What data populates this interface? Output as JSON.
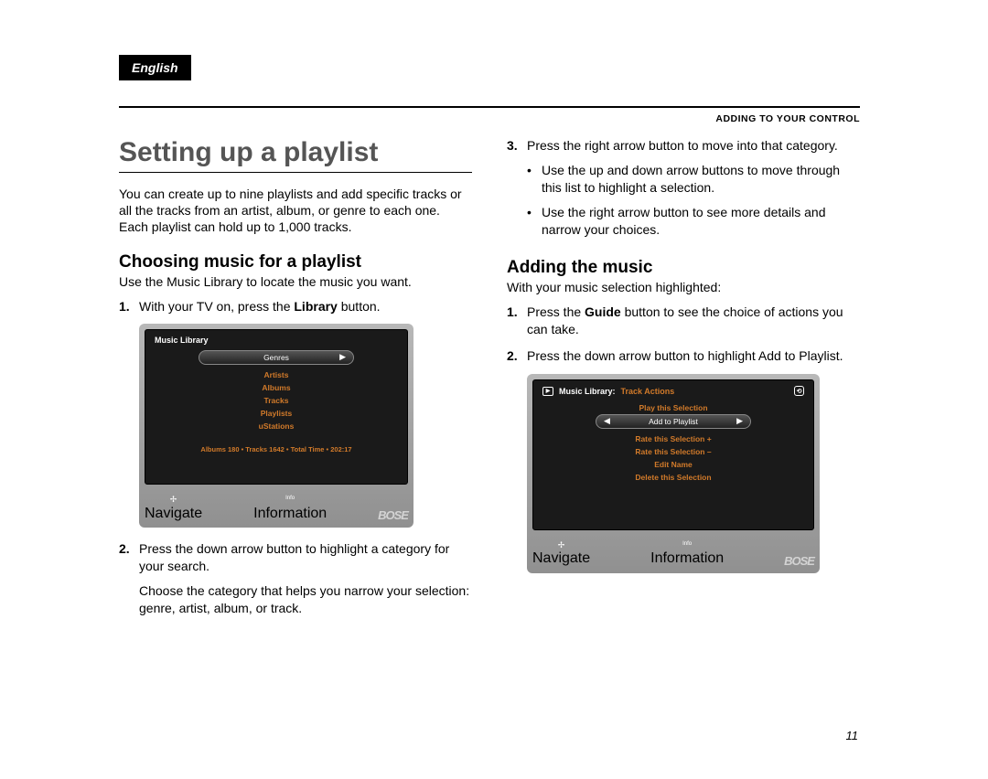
{
  "lang": "English",
  "sectionLabel": "ADDING TO YOUR CONTROL",
  "title": "Setting up a playlist",
  "intro": "You can create up to nine playlists and add specific tracks or all the tracks from an artist, album, or genre to each one. Each playlist can hold up to 1,000 tracks.",
  "left": {
    "h2": "Choosing music for a playlist",
    "desc": "Use the Music Library to locate the music you want.",
    "step1_pre": "With your TV on, press the ",
    "step1_bold": "Library",
    "step1_post": " button.",
    "step2a": "Press the down arrow button to highlight a category for your search.",
    "step2b": "Choose the category that helps you narrow your selection: genre, artist, album, or track."
  },
  "right": {
    "step3": "Press the right arrow button to move into that category.",
    "bullet1": "Use the up and down arrow buttons to move through this list to highlight a selection.",
    "bullet2": "Use the right arrow button to see more details and narrow your choices.",
    "h2": "Adding the music",
    "desc": "With your music selection highlighted:",
    "step1_pre": "Press the ",
    "step1_bold": "Guide",
    "step1_post": " button to see the choice of actions you can take.",
    "step2": "Press the down arrow button to highlight Add to Playlist."
  },
  "screen1": {
    "title": "Music Library",
    "selected": "Genres",
    "items": [
      "Artists",
      "Albums",
      "Tracks",
      "Playlists",
      "uStations"
    ],
    "status": "Albums 180 • Tracks 1642 • Total Time • 202:17",
    "navLabel": "Navigate",
    "infoTop": "Info",
    "infoLabel": "Information",
    "logo": "BOSE"
  },
  "screen2": {
    "titleA": "Music Library:",
    "titleB": "Track Actions",
    "top": "Play this Selection",
    "selected": "Add to Playlist",
    "items": [
      "Rate this Selection +",
      "Rate this Selection –",
      "Edit Name",
      "Delete this Selection"
    ],
    "navLabel": "Navigate",
    "infoTop": "Info",
    "infoLabel": "Information",
    "logo": "BOSE"
  },
  "pageNumber": "11"
}
